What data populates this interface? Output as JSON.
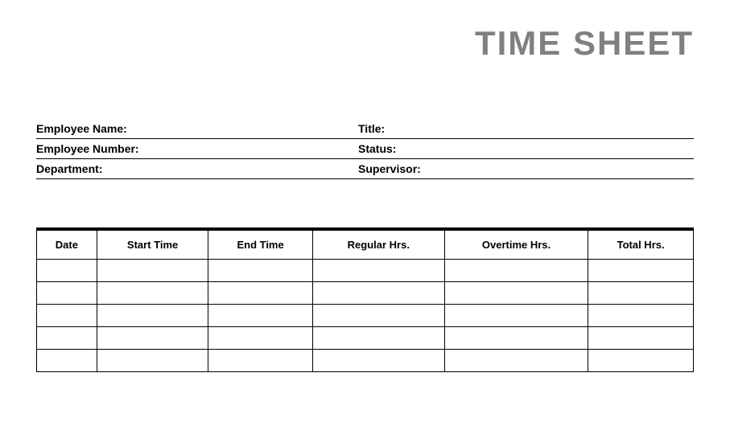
{
  "title": "TIME SHEET",
  "info": {
    "rows": [
      {
        "left": "Employee Name:",
        "right": "Title:"
      },
      {
        "left": "Employee Number:",
        "right": "Status:"
      },
      {
        "left": "Department:",
        "right": "Supervisor:"
      }
    ]
  },
  "table": {
    "headers": [
      "Date",
      "Start Time",
      "End Time",
      "Regular Hrs.",
      "Overtime Hrs.",
      "Total Hrs."
    ],
    "rows": [
      [
        "",
        "",
        "",
        "",
        "",
        ""
      ],
      [
        "",
        "",
        "",
        "",
        "",
        ""
      ],
      [
        "",
        "",
        "",
        "",
        "",
        ""
      ],
      [
        "",
        "",
        "",
        "",
        "",
        ""
      ],
      [
        "",
        "",
        "",
        "",
        "",
        ""
      ]
    ]
  }
}
